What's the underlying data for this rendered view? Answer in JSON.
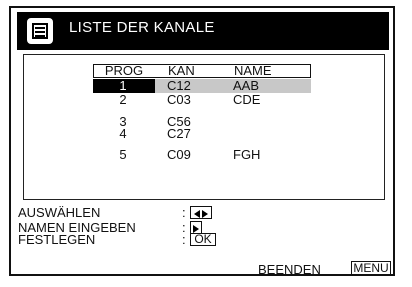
{
  "title": "LISTE DER KANALE",
  "icons": {
    "title": "channel-list-icon"
  },
  "columns": {
    "prog": "PROG",
    "kan": "KAN",
    "name": "NAME"
  },
  "rows": [
    {
      "prog": "1",
      "kan": "C12",
      "name": "AAB",
      "selected": true
    },
    {
      "prog": "2",
      "kan": "C03",
      "name": "CDE",
      "selected": false
    },
    {
      "prog": "3",
      "kan": "C56",
      "name": "",
      "selected": false
    },
    {
      "prog": "4",
      "kan": "C27",
      "name": "",
      "selected": false
    },
    {
      "prog": "5",
      "kan": "C09",
      "name": "FGH",
      "selected": false
    }
  ],
  "help": {
    "select_label": "AUSWÄHLEN",
    "name_label": "NAMEN EINGEBEN",
    "store_label": "FESTLEGEN",
    "colon": ":",
    "ok_label": "OK"
  },
  "footer": {
    "exit_label": "BEENDEN",
    "menu_label": "MENU"
  }
}
